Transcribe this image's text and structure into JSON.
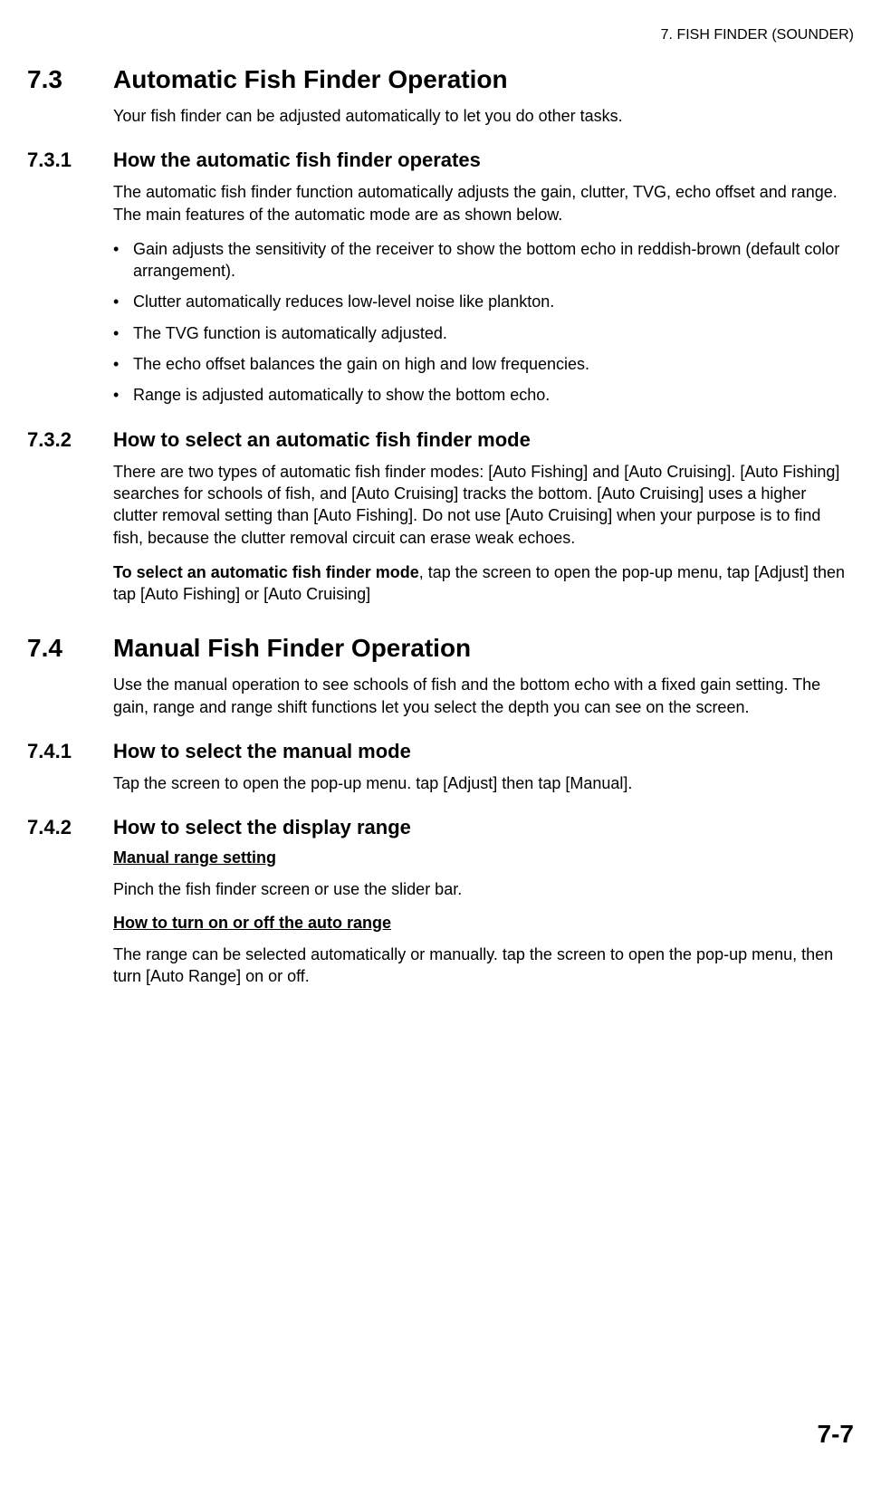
{
  "header": {
    "running": "7.  FISH FINDER (SOUNDER)"
  },
  "sections": [
    {
      "num": "7.3",
      "title": "Automatic Fish Finder Operation",
      "intro": "Your fish finder can be adjusted automatically to let you do other tasks.",
      "subs": [
        {
          "num": "7.3.1",
          "title": "How the automatic fish finder operates",
          "para1": "The automatic fish finder function automatically adjusts the gain, clutter, TVG, echo offset and range. The main features of the automatic mode are as shown below.",
          "bullets": [
            "Gain adjusts the sensitivity of the receiver to show the bottom echo in reddish-brown (default color arrangement).",
            "Clutter automatically reduces low-level noise like plankton.",
            "The TVG function is automatically adjusted.",
            "The echo offset balances the gain on high and low frequencies.",
            "Range is adjusted automatically to show the bottom echo."
          ]
        },
        {
          "num": "7.3.2",
          "title": "How to select an automatic fish finder mode",
          "para1": "There are two types of automatic fish finder modes: [Auto Fishing] and [Auto Cruising]. [Auto Fishing] searches for schools of fish, and [Auto Cruising] tracks the bottom. [Auto Cruising] uses a higher clutter removal setting than [Auto Fishing]. Do not use [Auto Cruising] when your purpose is to find fish, because the clutter removal circuit can erase weak echoes.",
          "para2_bold": "To select an automatic fish finder mode",
          "para2_rest": ", tap the screen to open the pop-up menu, tap [Adjust] then tap [Auto Fishing] or [Auto Cruising]"
        }
      ]
    },
    {
      "num": "7.4",
      "title": "Manual Fish Finder Operation",
      "intro": "Use the manual operation to see schools of fish and the bottom echo with a fixed gain setting. The gain, range and range shift functions let you select the depth you can see on the screen.",
      "subs": [
        {
          "num": "7.4.1",
          "title": "How to select the manual mode",
          "para1": "Tap the screen to open the pop-up menu. tap [Adjust] then tap [Manual]."
        },
        {
          "num": "7.4.2",
          "title": "How to select the display range",
          "subheads": [
            {
              "h": "Manual range setting",
              "p": "Pinch the fish finder screen or use the slider bar."
            },
            {
              "h": "How to turn on or off the auto range",
              "p": "The range can be selected automatically or manually. tap the screen to open the pop-up menu, then turn [Auto Range] on or off."
            }
          ]
        }
      ]
    }
  ],
  "pageNumber": "7-7"
}
